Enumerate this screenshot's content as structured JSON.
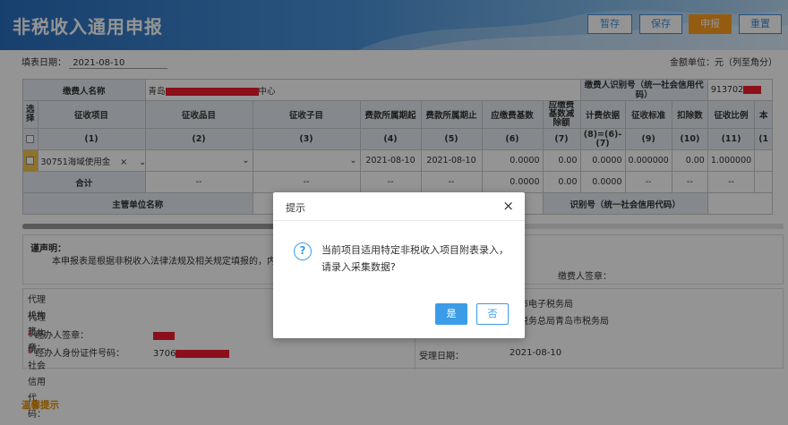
{
  "header": {
    "title": "非税收入通用申报",
    "buttons": {
      "save_draft": "暂存",
      "save": "保存",
      "submit": "申报",
      "reset": "重置"
    }
  },
  "info": {
    "fill_date_label": "填表日期：",
    "fill_date": "2021-08-10",
    "unit": "金额单位：元（列至角分）"
  },
  "table": {
    "payer_name_label": "缴费人名称",
    "payer_name_prefix": "青岛",
    "payer_name_suffix": "中心",
    "payer_id_label": "缴费人识别号（统一社会信用代码）",
    "payer_id_prefix": "913702",
    "headers": [
      "选择",
      "征收项目",
      "征收品目",
      "征收子目",
      "费款所属期起",
      "费款所属期止",
      "应缴费基数",
      "应缴费基数减除额",
      "计费依据",
      "征收标准",
      "扣除数",
      "征收比例",
      "本"
    ],
    "header_nums": [
      "(1)",
      "(2)",
      "(3)",
      "(4)",
      "(5)",
      "(6)",
      "(7)",
      "(8)=(6)-(7)",
      "(9)",
      "(10)",
      "(11)",
      "(1"
    ],
    "header_nums_extra": "(1",
    "row": {
      "item": "30751海域使用金",
      "clear": "×",
      "period_start": "2021-08-10",
      "period_end": "2021-08-10",
      "base": "0.0000",
      "deduct_base": "0.00",
      "basis": "0.0000",
      "standard": "0.000000",
      "deduction": "0.00",
      "ratio": "1.000000"
    },
    "total": {
      "label": "合计",
      "c2": "--",
      "c3": "--",
      "c4": "--",
      "c5": "--",
      "base": "0.0000",
      "deduct_base": "0.00",
      "basis": "0.0000",
      "c9": "--",
      "c10": "--",
      "c11": "--"
    },
    "dept_label": "主管单位名称",
    "dept_id_label": "识别号（统一社会信用代码）"
  },
  "declaration": {
    "title": "谨声明：",
    "body": "本申报表是根据非税收入法律法规及相关规定填报的，内容是",
    "signature_label": "缴费人签章："
  },
  "agent": {
    "org_seal_label": "代理机构签章：",
    "org_code_label": "代理机构统一社会信用代码：",
    "handler_label": "经办人签章：",
    "handler_id_label": "经办人身份证件号码：",
    "handler_id_prefix": "3706",
    "accept_org_1": "市电子税务局",
    "accept_org_2": "税务总局青岛市税务局",
    "accept_date_label": "受理日期：",
    "accept_date": "2021-08-10"
  },
  "tips": {
    "label": "温馨提示"
  },
  "dialog": {
    "title": "提示",
    "close": "×",
    "icon": "?",
    "message": "当前项目适用特定非税收入项目附表录入，请录入采集数据?",
    "yes": "是",
    "no": "否"
  },
  "colors": {
    "brand_blue": "#3b8ee0",
    "orange": "#ff9f1c",
    "redaction": "#f01d2f"
  }
}
